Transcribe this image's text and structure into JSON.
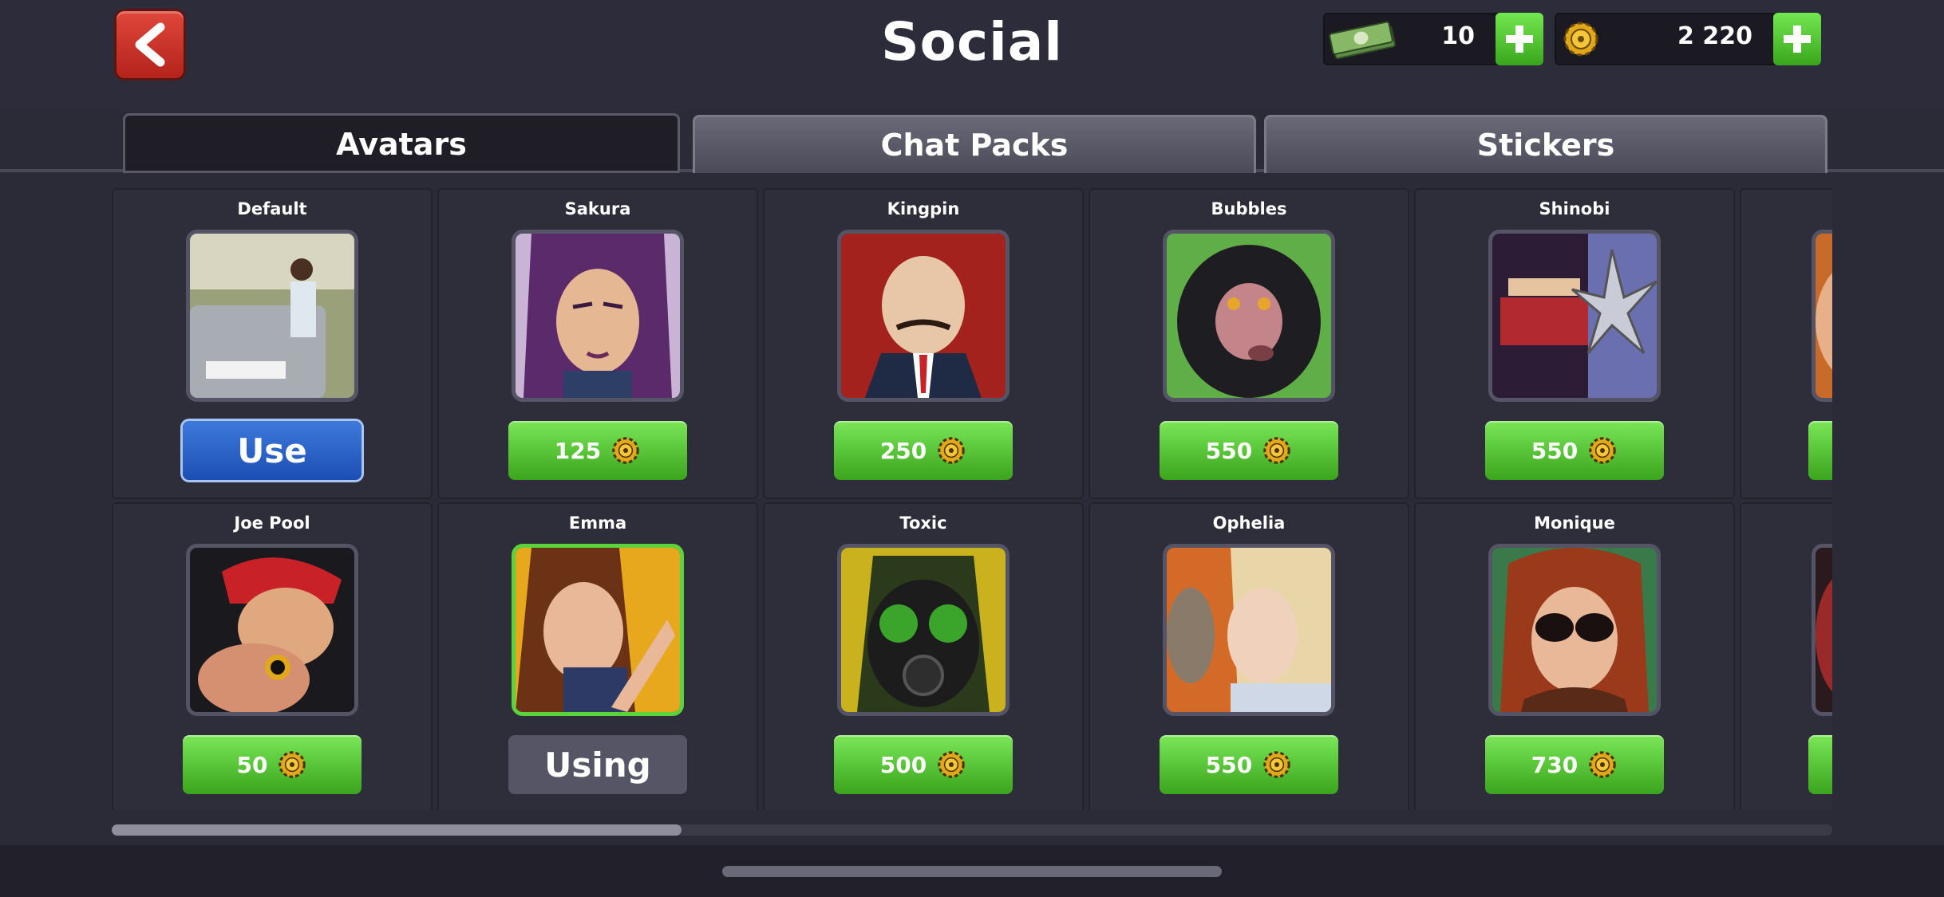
{
  "header": {
    "title": "Social",
    "cash_amount": "10",
    "coins_amount": "2 220"
  },
  "tabs": [
    {
      "label": "Avatars",
      "active": true
    },
    {
      "label": "Chat Packs",
      "active": false
    },
    {
      "label": "Stickers",
      "active": false
    }
  ],
  "avatars": [
    {
      "name": "Default",
      "action": "Use",
      "state": "owned"
    },
    {
      "name": "Sakura",
      "price": "125",
      "state": "buy"
    },
    {
      "name": "Kingpin",
      "price": "250",
      "state": "buy"
    },
    {
      "name": "Bubbles",
      "price": "550",
      "state": "buy"
    },
    {
      "name": "Shinobi",
      "price": "550",
      "state": "buy"
    },
    {
      "name": "Joe Pool",
      "price": "50",
      "state": "buy"
    },
    {
      "name": "Emma",
      "action": "Using",
      "state": "using"
    },
    {
      "name": "Toxic",
      "price": "500",
      "state": "buy"
    },
    {
      "name": "Ophelia",
      "price": "550",
      "state": "buy"
    },
    {
      "name": "Monique",
      "price": "730",
      "state": "buy"
    }
  ],
  "colors": {
    "accent_green": "#5bd33a",
    "use_blue": "#2a63c8",
    "back_red": "#c9302a",
    "coin_gold": "#e0a81a"
  },
  "scroll": {
    "position_fraction": 0.0,
    "visible_fraction": 0.33
  }
}
